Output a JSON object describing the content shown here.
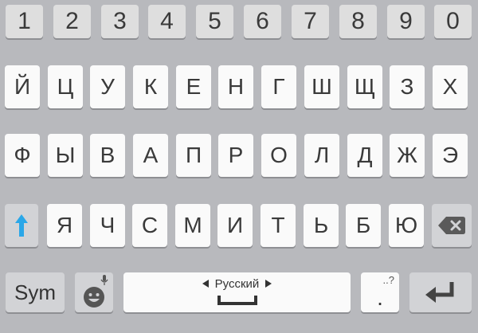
{
  "number_row": [
    "1",
    "2",
    "3",
    "4",
    "5",
    "6",
    "7",
    "8",
    "9",
    "0"
  ],
  "row1": [
    "Й",
    "Ц",
    "У",
    "К",
    "Е",
    "Н",
    "Г",
    "Ш",
    "Щ",
    "З",
    "Х"
  ],
  "row2": [
    "Ф",
    "Ы",
    "В",
    "А",
    "П",
    "Р",
    "О",
    "Л",
    "Д",
    "Ж",
    "Э"
  ],
  "row3": [
    "Я",
    "Ч",
    "С",
    "М",
    "И",
    "Т",
    "Ь",
    "Б",
    "Ю"
  ],
  "bottom": {
    "sym_label": "Sym",
    "emoji_icon": "emoji-icon",
    "mic_icon": "microphone-icon",
    "space_language": "Русский",
    "punct_hint": "..?",
    "punct_key": ".",
    "shift_icon": "shift-arrow-icon",
    "backspace_icon": "backspace-icon",
    "enter_icon": "enter-icon"
  },
  "colors": {
    "background": "#b8b9bd",
    "key_letter": "#fafafa",
    "key_number": "#dedede",
    "key_function": "#d2d3d6",
    "shift_accent": "#2aa7e8",
    "text": "#3a3a3a"
  }
}
